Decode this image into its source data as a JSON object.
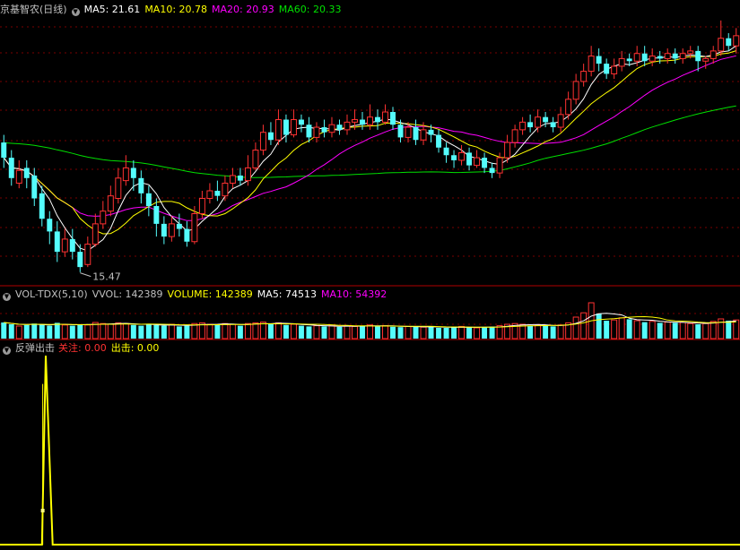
{
  "colors": {
    "up": "#ff3232",
    "down": "#54fcfc",
    "ma5": "#ffffff",
    "ma10": "#ffff00",
    "ma20": "#ff00ff",
    "ma60": "#00e000",
    "grid": "#7a0000",
    "separator": "#b00000",
    "label_gray": "#c0c0c0",
    "signal_line": "#ffff00",
    "watch_color": "#ff3232",
    "exit_color": "#ffff00"
  },
  "price_panel": {
    "title": "京基智农(日线)",
    "ma_labels": [
      "MA5: 21.61",
      "MA10: 20.78",
      "MA20: 20.93",
      "MA60: 20.33"
    ],
    "low_marker": "15.47"
  },
  "volume_panel": {
    "title": "VOL-TDX(5,10)",
    "vvol": "VVOL: 142389",
    "volume": "VOLUME: 142389",
    "ma5": "MA5: 74513",
    "ma10": "MA10: 54392"
  },
  "indicator_panel": {
    "title": "反弹出击",
    "watch_label": "关注",
    "watch_value": ": 0.00",
    "exit_label": "出击",
    "exit_value": ": 0.00"
  },
  "chart_data": {
    "type": "candlestick",
    "price_range": [
      15.0,
      25.5
    ],
    "low_marker_value": 15.47,
    "candles": [
      [
        20.6,
        20.0,
        20.9,
        19.6
      ],
      [
        20.0,
        19.2,
        20.3,
        18.9
      ],
      [
        19.0,
        19.5,
        19.9,
        18.8
      ],
      [
        19.6,
        19.2,
        19.9,
        18.8
      ],
      [
        19.3,
        18.4,
        19.6,
        18.1
      ],
      [
        18.6,
        17.6,
        18.9,
        17.3
      ],
      [
        17.6,
        17.1,
        17.9,
        16.6
      ],
      [
        17.1,
        16.3,
        17.5,
        15.9
      ],
      [
        16.3,
        16.8,
        17.2,
        16.1
      ],
      [
        16.8,
        16.3,
        17.2,
        16.0
      ],
      [
        16.3,
        15.7,
        16.6,
        15.5
      ],
      [
        15.8,
        16.6,
        16.9,
        15.7
      ],
      [
        16.6,
        17.4,
        17.8,
        16.5
      ],
      [
        17.4,
        17.9,
        18.3,
        17.2
      ],
      [
        17.9,
        18.5,
        18.9,
        17.7
      ],
      [
        18.4,
        19.2,
        19.6,
        18.2
      ],
      [
        19.1,
        19.6,
        20.1,
        18.9
      ],
      [
        19.6,
        19.2,
        19.9,
        18.7
      ],
      [
        19.2,
        18.6,
        19.5,
        18.2
      ],
      [
        18.6,
        18.1,
        18.9,
        17.7
      ],
      [
        18.1,
        17.4,
        18.4,
        16.9
      ],
      [
        17.4,
        16.9,
        17.7,
        16.6
      ],
      [
        16.9,
        17.4,
        17.7,
        16.7
      ],
      [
        17.4,
        17.2,
        17.8,
        16.9
      ],
      [
        17.2,
        16.7,
        17.5,
        16.5
      ],
      [
        16.7,
        17.8,
        18.1,
        16.6
      ],
      [
        17.8,
        18.4,
        18.7,
        17.6
      ],
      [
        18.4,
        18.7,
        19.0,
        18.2
      ],
      [
        18.7,
        18.5,
        19.1,
        18.3
      ],
      [
        18.5,
        19.0,
        19.3,
        18.3
      ],
      [
        19.0,
        19.3,
        19.6,
        18.8
      ],
      [
        19.3,
        19.1,
        19.6,
        18.9
      ],
      [
        19.1,
        19.6,
        20.1,
        18.9
      ],
      [
        19.6,
        20.3,
        20.6,
        19.5
      ],
      [
        20.3,
        21.0,
        21.3,
        20.1
      ],
      [
        21.0,
        20.7,
        21.4,
        20.5
      ],
      [
        20.7,
        21.5,
        21.9,
        20.5
      ],
      [
        21.5,
        20.9,
        21.7,
        20.6
      ],
      [
        20.9,
        21.5,
        21.9,
        20.8
      ],
      [
        21.5,
        21.3,
        21.7,
        21.0
      ],
      [
        21.3,
        20.8,
        21.6,
        20.6
      ],
      [
        20.8,
        21.2,
        21.4,
        20.6
      ],
      [
        21.2,
        21.0,
        21.5,
        20.8
      ],
      [
        21.0,
        21.3,
        21.6,
        20.8
      ],
      [
        21.3,
        21.1,
        21.5,
        20.9
      ],
      [
        21.1,
        21.4,
        21.7,
        20.9
      ],
      [
        21.4,
        21.5,
        21.9,
        21.1
      ],
      [
        21.5,
        21.3,
        21.8,
        21.1
      ],
      [
        21.3,
        21.6,
        22.1,
        21.1
      ],
      [
        21.6,
        21.4,
        21.9,
        21.1
      ],
      [
        21.4,
        21.8,
        22.1,
        21.3
      ],
      [
        21.8,
        21.3,
        22.0,
        21.1
      ],
      [
        21.3,
        20.8,
        21.5,
        20.6
      ],
      [
        20.8,
        21.2,
        21.4,
        20.6
      ],
      [
        21.2,
        20.7,
        21.5,
        20.5
      ],
      [
        20.7,
        21.1,
        21.4,
        20.5
      ],
      [
        21.1,
        20.9,
        21.3,
        20.6
      ],
      [
        20.9,
        20.4,
        21.1,
        20.2
      ],
      [
        20.4,
        20.1,
        20.6,
        19.8
      ],
      [
        20.1,
        19.9,
        20.3,
        19.6
      ],
      [
        19.9,
        20.2,
        20.5,
        19.7
      ],
      [
        20.2,
        19.7,
        20.4,
        19.5
      ],
      [
        19.7,
        20.0,
        20.3,
        19.6
      ],
      [
        20.0,
        19.6,
        20.2,
        19.4
      ],
      [
        19.6,
        19.4,
        19.8,
        19.2
      ],
      [
        19.4,
        20.0,
        20.2,
        19.2
      ],
      [
        20.0,
        20.6,
        20.9,
        19.8
      ],
      [
        20.6,
        21.1,
        21.3,
        20.4
      ],
      [
        21.1,
        21.4,
        21.6,
        20.9
      ],
      [
        21.4,
        21.2,
        21.7,
        21.0
      ],
      [
        21.2,
        21.6,
        21.9,
        21.0
      ],
      [
        21.6,
        21.4,
        21.8,
        21.2
      ],
      [
        21.4,
        21.2,
        21.6,
        21.0
      ],
      [
        21.2,
        21.7,
        22.0,
        21.0
      ],
      [
        21.7,
        22.3,
        22.6,
        21.5
      ],
      [
        22.3,
        23.0,
        23.3,
        22.1
      ],
      [
        23.0,
        23.4,
        23.7,
        22.8
      ],
      [
        23.4,
        24.0,
        24.4,
        23.2
      ],
      [
        24.0,
        23.7,
        24.3,
        23.4
      ],
      [
        23.7,
        23.3,
        23.9,
        23.1
      ],
      [
        23.3,
        23.6,
        23.9,
        23.1
      ],
      [
        23.6,
        23.9,
        24.2,
        23.4
      ],
      [
        23.9,
        23.8,
        24.1,
        23.6
      ],
      [
        23.8,
        24.1,
        24.4,
        23.6
      ],
      [
        24.1,
        23.8,
        24.4,
        23.6
      ],
      [
        23.8,
        24.0,
        24.3,
        23.6
      ],
      [
        24.0,
        23.9,
        24.2,
        23.7
      ],
      [
        23.9,
        24.1,
        24.3,
        23.7
      ],
      [
        24.1,
        23.9,
        24.3,
        23.7
      ],
      [
        23.9,
        24.1,
        24.3,
        23.7
      ],
      [
        24.1,
        24.2,
        24.4,
        23.9
      ],
      [
        24.2,
        23.8,
        24.4,
        23.4
      ],
      [
        23.8,
        23.9,
        24.0,
        23.5
      ],
      [
        23.9,
        24.2,
        24.4,
        23.7
      ],
      [
        24.2,
        24.7,
        25.4,
        24.0
      ],
      [
        24.7,
        24.4,
        24.9,
        24.2
      ],
      [
        24.4,
        24.8,
        25.1,
        24.1
      ]
    ],
    "volumes": [
      0.45,
      0.4,
      0.35,
      0.38,
      0.42,
      0.4,
      0.36,
      0.44,
      0.38,
      0.36,
      0.4,
      0.38,
      0.45,
      0.42,
      0.4,
      0.44,
      0.42,
      0.38,
      0.36,
      0.4,
      0.38,
      0.36,
      0.4,
      0.34,
      0.36,
      0.42,
      0.44,
      0.4,
      0.38,
      0.42,
      0.4,
      0.36,
      0.42,
      0.44,
      0.46,
      0.4,
      0.44,
      0.38,
      0.4,
      0.36,
      0.34,
      0.36,
      0.34,
      0.36,
      0.33,
      0.36,
      0.34,
      0.36,
      0.38,
      0.34,
      0.36,
      0.33,
      0.32,
      0.34,
      0.33,
      0.32,
      0.34,
      0.3,
      0.3,
      0.32,
      0.34,
      0.32,
      0.3,
      0.32,
      0.33,
      0.36,
      0.4,
      0.42,
      0.4,
      0.36,
      0.38,
      0.36,
      0.34,
      0.38,
      0.44,
      0.6,
      0.72,
      1.0,
      0.7,
      0.5,
      0.52,
      0.58,
      0.54,
      0.5,
      0.46,
      0.48,
      0.44,
      0.46,
      0.44,
      0.45,
      0.42,
      0.4,
      0.42,
      0.48,
      0.55,
      0.5,
      0.52
    ],
    "signal": {
      "spike_index": 5.5,
      "spike_value": 1.0,
      "pre_index": 5.0,
      "pre_value": 0.0,
      "secondary_index": 5.1,
      "secondary_value": 0.85,
      "marker_value": 0.18
    }
  }
}
